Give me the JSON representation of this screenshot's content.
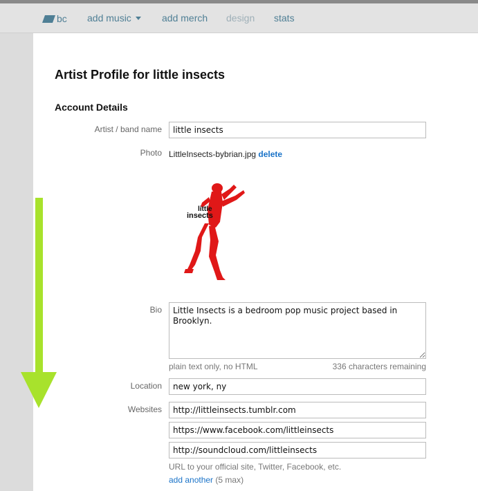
{
  "nav": {
    "logo_text": "bc",
    "items": [
      {
        "label": "add music",
        "has_dropdown": true
      },
      {
        "label": "add merch"
      },
      {
        "label": "design",
        "disabled": true
      },
      {
        "label": "stats"
      }
    ]
  },
  "page": {
    "title": "Artist Profile for little insects",
    "section_title": "Account Details"
  },
  "form": {
    "name_label": "Artist / band name",
    "name_value": "little insects",
    "photo_label": "Photo",
    "photo_filename": "LittleInsects-bybrian.jpg",
    "photo_delete": "delete",
    "photo_caption_line1": "little",
    "photo_caption_line2": "insects",
    "bio_label": "Bio",
    "bio_value": "Little Insects is a bedroom pop music project based in Brooklyn.",
    "bio_hint": "plain text only, no HTML",
    "bio_remaining": "336 characters remaining",
    "location_label": "Location",
    "location_value": "new york, ny",
    "websites_label": "Websites",
    "websites": [
      "http://littleinsects.tumblr.com",
      "https://www.facebook.com/littleinsects",
      "http://soundcloud.com/littleinsects"
    ],
    "websites_hint": "URL to your official site, Twitter, Facebook, etc.",
    "add_another": "add another",
    "add_another_max": "(5 max)"
  },
  "colors": {
    "link": "#1a73c8",
    "nav_link": "#4f7f95",
    "arrow": "#a8e22c",
    "photo_red": "#e01818"
  },
  "icons": {
    "logo": "bandcamp-logo-icon",
    "dropdown": "caret-down-icon",
    "scroll_arrow": "arrow-down-icon"
  }
}
